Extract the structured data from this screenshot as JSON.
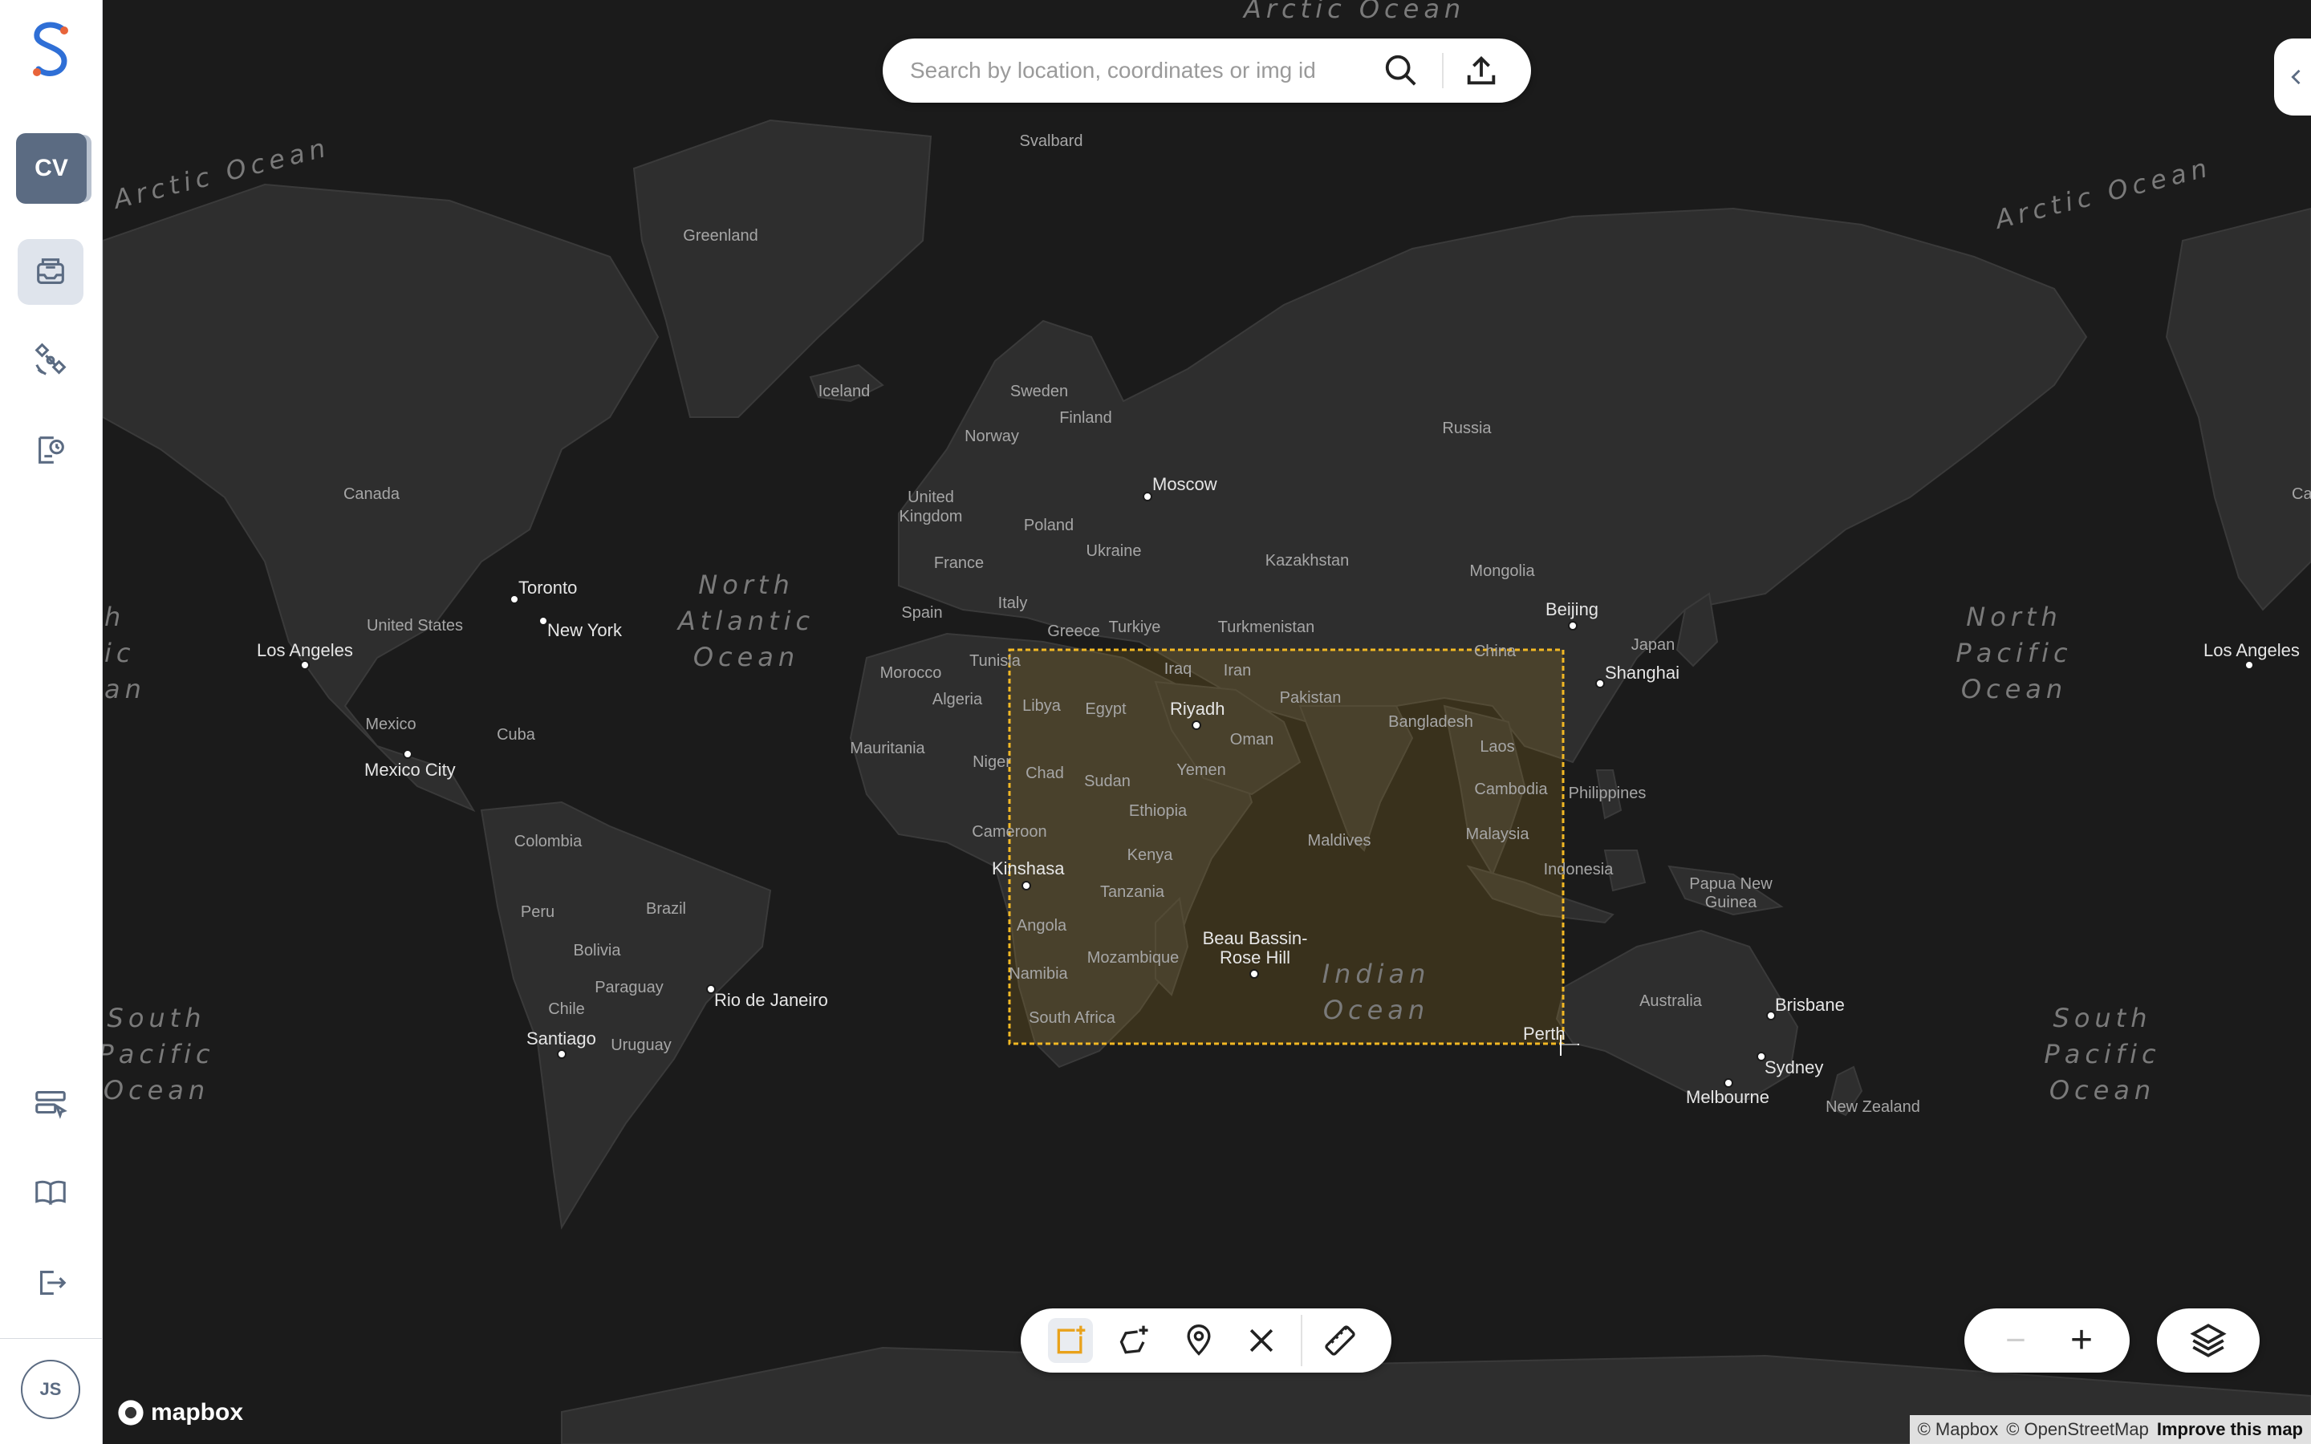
{
  "sidebar": {
    "badge": "CV",
    "user_initials": "JS",
    "items": [
      {
        "name": "inbox-icon"
      },
      {
        "name": "satellite-icon"
      },
      {
        "name": "history-icon"
      },
      {
        "name": "tasking-icon"
      },
      {
        "name": "docs-icon"
      },
      {
        "name": "logout-icon"
      }
    ],
    "colors": {
      "accent_badge": "#5b6b82",
      "logo_blue": "#2f6fd6",
      "logo_orange": "#e8643a"
    }
  },
  "search": {
    "placeholder": "Search by location, coordinates or img id",
    "value": ""
  },
  "map": {
    "oceans": {
      "arctic_left": "Arctic Ocean",
      "arctic_right": "Arctic Ocean",
      "arctic_top": "Arctic Ocean",
      "north_atlantic": [
        "North",
        "Atlantic",
        "Ocean"
      ],
      "north_pacific": [
        "North",
        "Pacific",
        "Ocean"
      ],
      "north_pacific_left": [
        "h",
        "ic",
        "an"
      ],
      "south_pacific_left": [
        "South",
        "Pacific",
        "Ocean"
      ],
      "south_pacific_right": [
        "South",
        "Pacific",
        "Ocean"
      ],
      "indian": [
        "Indian",
        "Ocean"
      ]
    },
    "countries": {
      "svalbard": "Svalbard",
      "greenland": "Greenland",
      "iceland": "Iceland",
      "sweden": "Sweden",
      "norway": "Norway",
      "finland": "Finland",
      "russia": "Russia",
      "united_kingdom": [
        "United",
        "Kingdom"
      ],
      "poland": "Poland",
      "ukraine": "Ukraine",
      "france": "France",
      "spain": "Spain",
      "italy": "Italy",
      "greece": "Greece",
      "turkiye": "Turkiye",
      "turkmenistan": "Turkmenistan",
      "kazakhstan": "Kazakhstan",
      "mongolia": "Mongolia",
      "china": "China",
      "japan": "Japan",
      "canada": "Canada",
      "united_states": "United States",
      "mexico": "Mexico",
      "cuba": "Cuba",
      "colombia": "Colombia",
      "peru": "Peru",
      "brazil": "Brazil",
      "bolivia": "Bolivia",
      "paraguay": "Paraguay",
      "chile": "Chile",
      "uruguay": "Uruguay",
      "morocco": "Morocco",
      "tunisia": "Tunisia",
      "algeria": "Algeria",
      "mauritania": "Mauritania",
      "niger": "Niger",
      "libya": "Libya",
      "egypt": "Egypt",
      "chad": "Chad",
      "sudan": "Sudan",
      "ethiopia": "Ethiopia",
      "cameroon": "Cameroon",
      "kenya": "Kenya",
      "tanzania": "Tanzania",
      "angola": "Angola",
      "namibia": "Namibia",
      "mozambique": "Mozambique",
      "south_africa": "South Africa",
      "iraq": "Iraq",
      "iran": "Iran",
      "pakistan": "Pakistan",
      "oman": "Oman",
      "yemen": "Yemen",
      "bangladesh": "Bangladesh",
      "laos": "Laos",
      "cambodia": "Cambodia",
      "malaysia": "Malaysia",
      "maldives": "Maldives",
      "indonesia": "Indonesia",
      "philippines": "Philippines",
      "papua_new_guinea": [
        "Papua New",
        "Guinea"
      ],
      "australia": "Australia",
      "new_zealand": "New Zealand",
      "canada_right": "Ca"
    },
    "cities": {
      "moscow": "Moscow",
      "toronto": "Toronto",
      "new_york": "New York",
      "los_angeles": "Los Angeles",
      "los_angeles_right": "Los Angeles",
      "mexico_city": "Mexico City",
      "rio": "Rio de Janeiro",
      "santiago": "Santiago",
      "beijing": "Beijing",
      "shanghai": "Shanghai",
      "riyadh": "Riyadh",
      "kinshasa": "Kinshasa",
      "beau_bassin": [
        "Beau Bassin-",
        "Rose Hill"
      ],
      "perth": "Perth",
      "brisbane": "Brisbane",
      "sydney": "Sydney",
      "melbourne": "Melbourne"
    },
    "selection_color": "#f2b824"
  },
  "draw_tools": {
    "items": [
      "draw-rectangle-icon",
      "draw-polygon-icon",
      "marker-pin-icon",
      "clear-icon",
      "ruler-icon"
    ],
    "active": "draw-rectangle-icon",
    "active_color": "#e9a21b"
  },
  "map_controls": {
    "zoom_out": "−",
    "zoom_in": "+"
  },
  "branding": {
    "mapbox": "mapbox"
  },
  "attribution": {
    "mapbox": "© Mapbox",
    "osm": "© OpenStreetMap",
    "improve": "Improve this map"
  }
}
